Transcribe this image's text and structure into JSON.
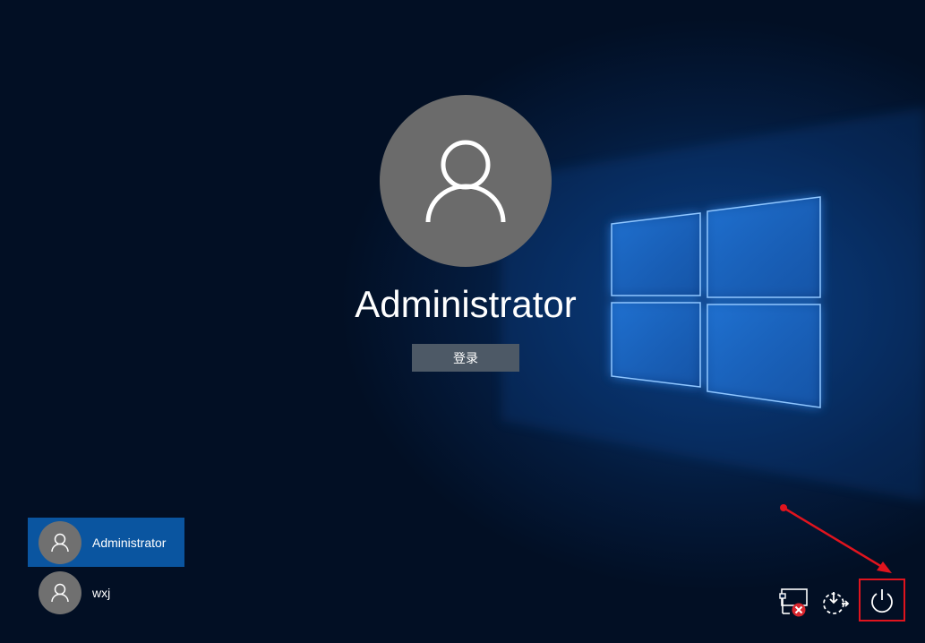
{
  "login": {
    "username": "Administrator",
    "signin_label": "登录"
  },
  "users": [
    {
      "name": "Administrator",
      "selected": true
    },
    {
      "name": "wxj",
      "selected": false
    }
  ],
  "system_icons": [
    "network-disconnected-icon",
    "ease-of-access-icon",
    "power-icon"
  ],
  "colors": {
    "selected_user": "#0a55a0",
    "highlight": "#e0141e",
    "signin_button": "#4d5966",
    "avatar": "#6b6b6b"
  }
}
